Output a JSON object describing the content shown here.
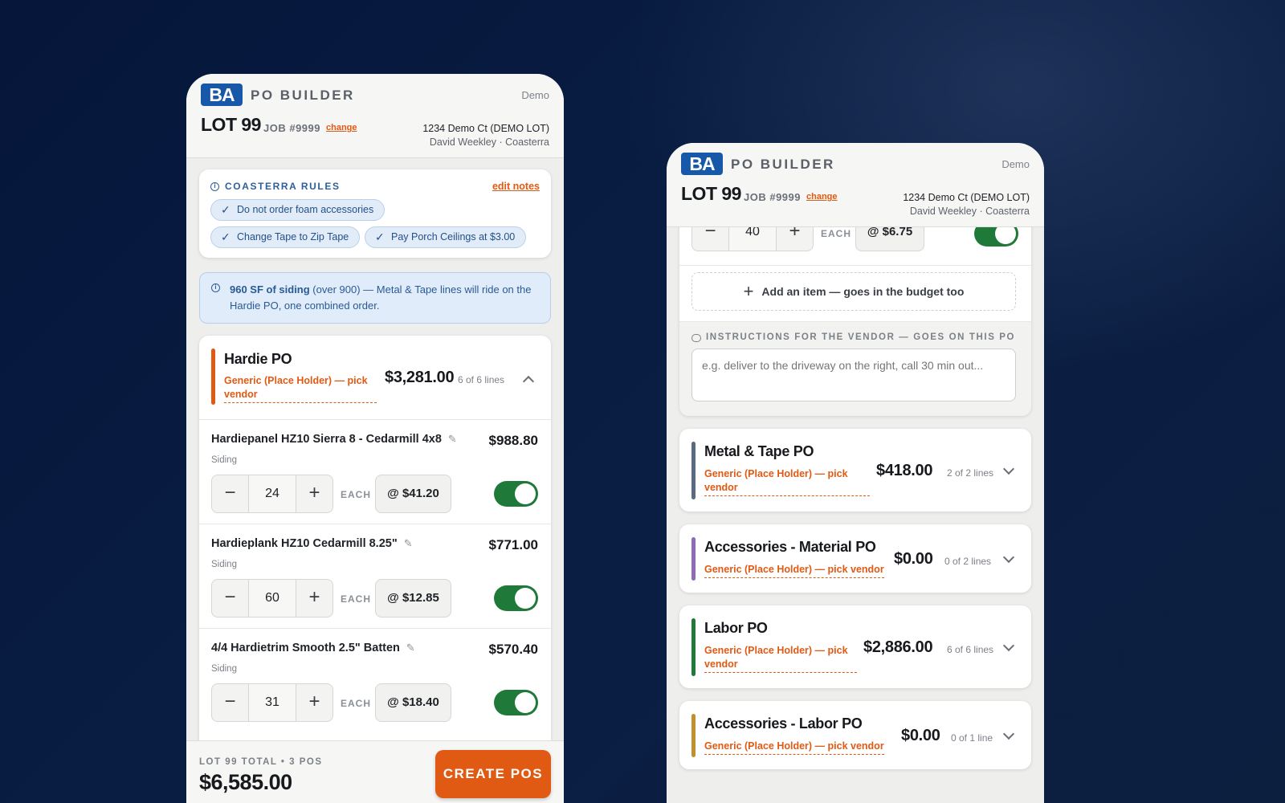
{
  "app": {
    "brand_logo": "BA",
    "brand_title": "PO BUILDER",
    "mode": "Demo",
    "lot": "LOT 99",
    "job": "JOB #9999",
    "change_label": "change",
    "address": "1234 Demo Ct (DEMO LOT)",
    "customer": "David Weekley · Coasterra",
    "accent_color": "#e05a14",
    "brand_color": "#1758a8",
    "toggle_on_color": "#1f7a3a"
  },
  "rules": {
    "title": "COASTERRA RULES",
    "edit_label": "edit notes",
    "chips": [
      "Do not order foam accessories",
      "Change Tape to Zip Tape",
      "Pay Porch Ceilings at $3.00"
    ]
  },
  "notice": {
    "highlight": "960 SF of siding",
    "text": " (over 900) — Metal & Tape lines will ride on the Hardie PO, one combined order."
  },
  "hardie_po": {
    "name": "Hardie PO",
    "vendor": "Generic (Place Holder) — pick vendor",
    "total": "$3,281.00",
    "lines": "6 of 6 lines",
    "bar_color": "#e05a14",
    "items": [
      {
        "name": "Hardiepanel HZ10 Sierra 8 - Cedarmill 4x8",
        "price": "$988.80",
        "category": "Siding",
        "qty": "24",
        "unit": "EACH",
        "rate": "@ $41.20",
        "enabled": true
      },
      {
        "name": "Hardieplank HZ10 Cedarmill 8.25\"",
        "price": "$771.00",
        "category": "Siding",
        "qty": "60",
        "unit": "EACH",
        "rate": "@ $12.85",
        "enabled": true
      },
      {
        "name": "4/4 Hardietrim Smooth 2.5\" Batten",
        "price": "$570.40",
        "category": "Siding",
        "qty": "31",
        "unit": "EACH",
        "rate": "@ $18.40",
        "enabled": true
      }
    ]
  },
  "footer": {
    "label": "LOT 99 TOTAL • 3 POS",
    "total": "$6,585.00",
    "create_label": "CREATE POS"
  },
  "right": {
    "partial_item": {
      "qty": "40",
      "unit": "EACH",
      "rate": "@ $6.75",
      "enabled": true
    },
    "add_item_label": "Add an item — goes in the budget too",
    "instructions_label": "INSTRUCTIONS FOR THE VENDOR — GOES ON THIS PO",
    "instructions_placeholder": "e.g. deliver to the driveway on the right, call 30 min out...",
    "pos": [
      {
        "name": "Metal & Tape PO",
        "vendor": "Generic (Place Holder) — pick vendor",
        "total": "$418.00",
        "lines": "2 of 2 lines",
        "bar_color": "#5a6a82"
      },
      {
        "name": "Accessories - Material PO",
        "vendor": "Generic (Place Holder) — pick vendor",
        "total": "$0.00",
        "lines": "0 of 2 lines",
        "bar_color": "#8e6bb8"
      },
      {
        "name": "Labor PO",
        "vendor": "Generic (Place Holder) — pick vendor",
        "total": "$2,886.00",
        "lines": "6 of 6 lines",
        "bar_color": "#1f7a3a"
      },
      {
        "name": "Accessories - Labor PO",
        "vendor": "Generic (Place Holder) — pick vendor",
        "total": "$0.00",
        "lines": "0 of 1 line",
        "bar_color": "#c0902c"
      }
    ]
  }
}
